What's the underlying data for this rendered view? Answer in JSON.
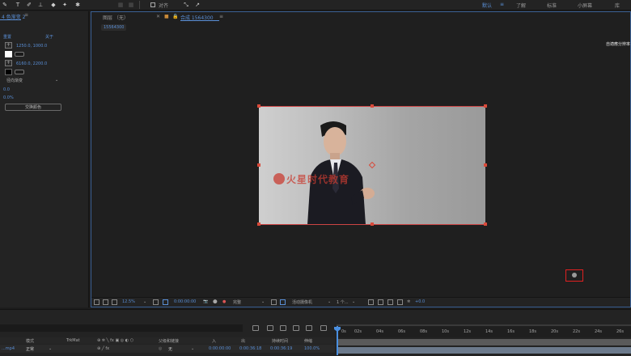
{
  "toolbar": {
    "snap_label": "对齐",
    "workspaces": [
      {
        "label": "默认",
        "active": true
      },
      {
        "label": "了解",
        "active": false
      },
      {
        "label": "标准",
        "active": false
      },
      {
        "label": "小屏幕",
        "active": false
      },
      {
        "label": "库",
        "active": false
      }
    ]
  },
  "effects_panel": {
    "tab": "4 色渐变 2",
    "reset": "重置",
    "about": "关于",
    "start_point": "1250.0, 1000.0",
    "end_point": "6160.0, 2200.0",
    "ramp_shape": "径向渐变",
    "scatter": "0.0",
    "blend": "0.0%",
    "swap_button": "交换颜色",
    "start_color": "#ffffff",
    "end_color": "#000000"
  },
  "comp_panel": {
    "tabs": [
      {
        "label": "图层 （无）",
        "active": false
      },
      {
        "label": "合成 1564300",
        "active": true
      }
    ],
    "breadcrumb": "15564300",
    "right_note": "自適應分辨率",
    "watermark_text": "火星时代教育"
  },
  "comp_bar": {
    "zoom": "12.5%",
    "timecode": "0:00:00:00",
    "resolution": "完整",
    "camera": "活动摄像机",
    "views": "1 个...",
    "exposure": "+0.0"
  },
  "timeline": {
    "columns": {
      "mode": "模式",
      "trkmat": "TrkMat",
      "parent": "父级和链接",
      "in": "入",
      "out": "出",
      "duration": "持续时间",
      "stretch": "伸缩"
    },
    "row": {
      "name": "...mp4",
      "mode": "正常",
      "parent": "无",
      "in": "0:00:00:00",
      "out": "0:00:36:18",
      "duration": "0:00:36:19",
      "stretch": "100.0%"
    },
    "ruler_ticks": [
      "0s",
      "02s",
      "04s",
      "06s",
      "08s",
      "10s",
      "12s",
      "14s",
      "16s",
      "18s",
      "20s",
      "22s",
      "24s",
      "26s"
    ]
  }
}
